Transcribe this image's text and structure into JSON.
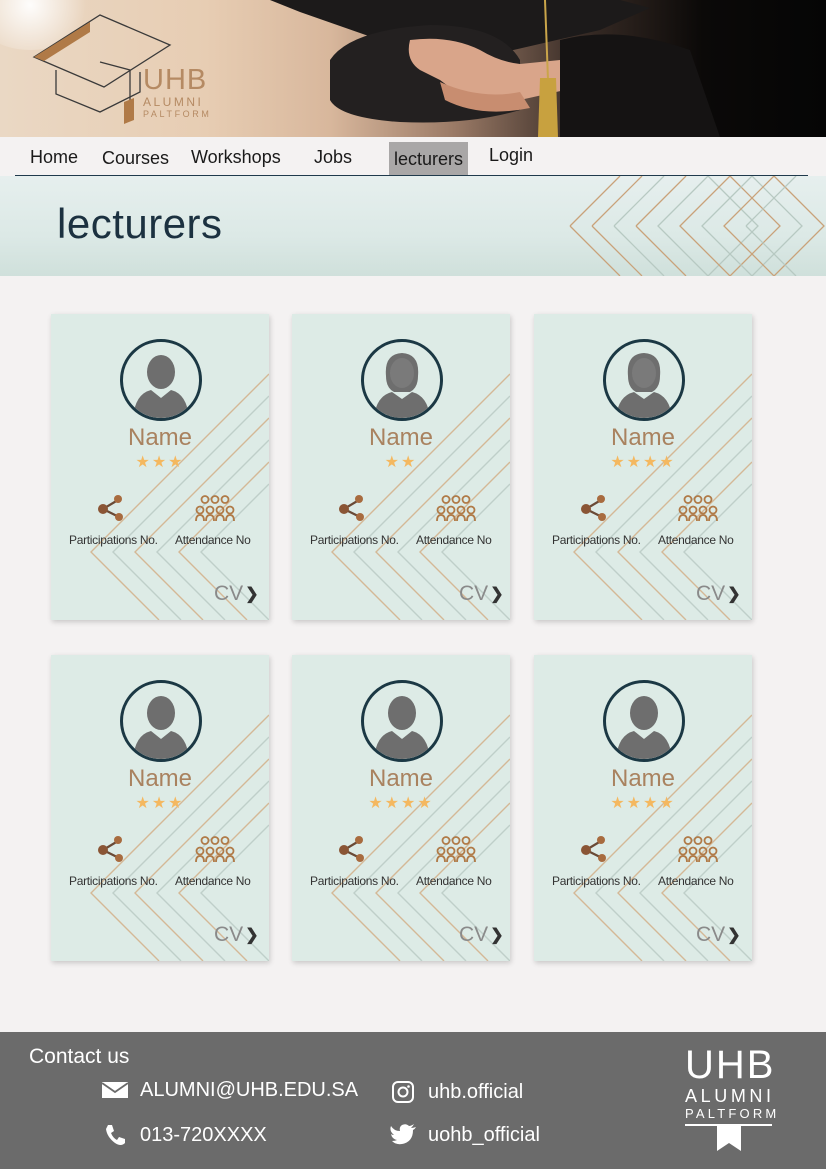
{
  "brand": {
    "name": "UHB",
    "line1": "ALUMNI",
    "line2": "PALTFORM"
  },
  "nav": {
    "items": [
      {
        "label": "Home"
      },
      {
        "label": "Courses"
      },
      {
        "label": "Workshops"
      },
      {
        "label": "Jobs"
      },
      {
        "label": "lecturers",
        "active": true
      },
      {
        "label": "Login"
      }
    ]
  },
  "page": {
    "title": "lecturers"
  },
  "cards": [
    {
      "name": "Name",
      "stars": "★★★",
      "rating": 3,
      "participations_label": "Participations No.",
      "attendance_label": "Attendance No",
      "cv_label": "CV",
      "avatar": "male"
    },
    {
      "name": "Name",
      "stars": "★★",
      "rating": 2,
      "participations_label": "Participations No.",
      "attendance_label": "Attendance No",
      "cv_label": "CV",
      "avatar": "female"
    },
    {
      "name": "Name",
      "stars": "★★★★",
      "rating": 4,
      "participations_label": "Participations No.",
      "attendance_label": "Attendance No",
      "cv_label": "CV",
      "avatar": "female"
    },
    {
      "name": "Name",
      "stars": "★★★",
      "rating": 3,
      "participations_label": "Participations No.",
      "attendance_label": "Attendance No",
      "cv_label": "CV",
      "avatar": "male"
    },
    {
      "name": "Name",
      "stars": "★★★★",
      "rating": 4,
      "participations_label": "Participations No.",
      "attendance_label": "Attendance No",
      "cv_label": "CV",
      "avatar": "male"
    },
    {
      "name": "Name",
      "stars": "★★★★",
      "rating": 4,
      "participations_label": "Participations No.",
      "attendance_label": "Attendance No",
      "cv_label": "CV",
      "avatar": "male"
    }
  ],
  "footer": {
    "contact_title": "Contact us",
    "email": "ALUMNI@UHB.EDU.SA",
    "phone": "013-720XXXX",
    "instagram": "uhb.official",
    "twitter": "uohb_official"
  },
  "colors": {
    "accent": "#a9825f",
    "star": "#f4b860",
    "card_bg": "#ddebe6",
    "footer_bg": "#6b6b6b",
    "nav_active_bg": "#a9a7a7",
    "avatar_ring": "#1b3844"
  }
}
